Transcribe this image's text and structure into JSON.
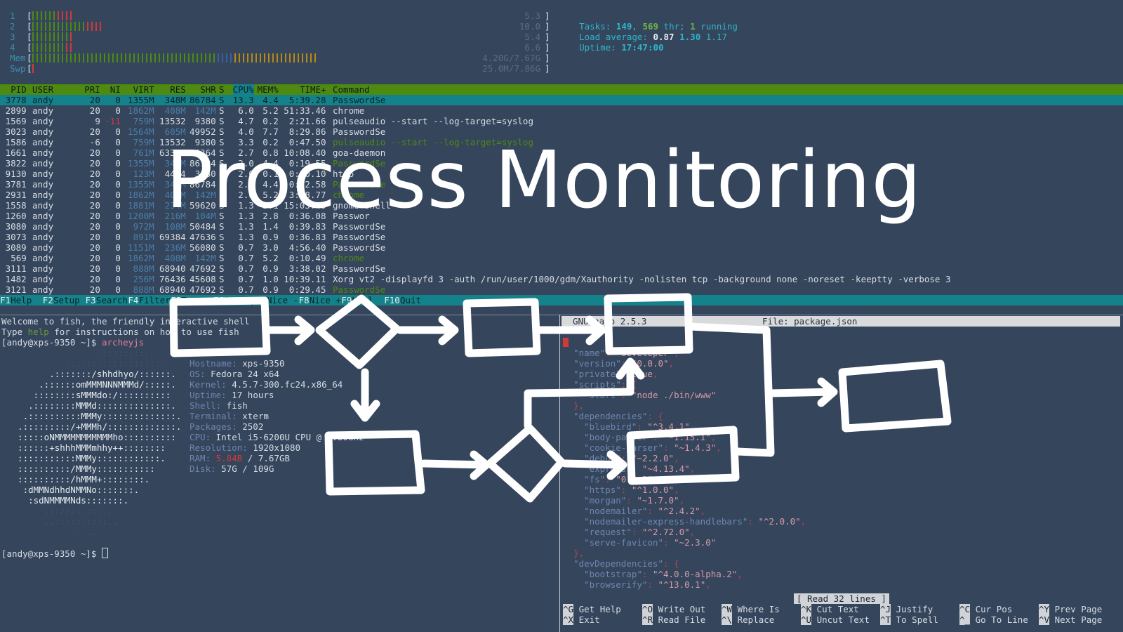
{
  "htop": {
    "meters": [
      {
        "label": "1",
        "value": "5.3",
        "segs": [
          [
            "#4f8a10",
            6
          ],
          [
            "#d23a3a",
            4
          ]
        ]
      },
      {
        "label": "2",
        "value": "10.0",
        "segs": [
          [
            "#4f8a10",
            13
          ],
          [
            "#d23a3a",
            4
          ]
        ]
      },
      {
        "label": "3",
        "value": "5.4",
        "segs": [
          [
            "#4f8a10",
            9
          ],
          [
            "#d23a3a",
            1
          ]
        ]
      },
      {
        "label": "4",
        "value": "6.6",
        "segs": [
          [
            "#4f8a10",
            8
          ],
          [
            "#d23a3a",
            2
          ]
        ]
      },
      {
        "label": "Mem",
        "value": "4.20G/7.67G",
        "segs": [
          [
            "#4f8a10",
            44
          ],
          [
            "#3d5fa0",
            4
          ],
          [
            "#b88a10",
            20
          ]
        ]
      },
      {
        "label": "Swp",
        "value": "25.0M/7.86G",
        "segs": [
          [
            "#d23a3a",
            1
          ]
        ]
      }
    ],
    "tasks_label": "Tasks:",
    "tasks_count": "149",
    "tasks_thr_count": "569",
    "tasks_thr_label": "thr;",
    "tasks_running_count": "1",
    "tasks_running_label": "running",
    "load_label": "Load average:",
    "load_1": "0.87",
    "load_5": "1.30",
    "load_15": "1.17",
    "uptime_label": "Uptime:",
    "uptime_value": "17:47:00",
    "columns": [
      "PID",
      "USER",
      "PRI",
      "NI",
      "VIRT",
      "RES",
      "SHR",
      "S",
      "CPU%",
      "MEM%",
      "TIME+",
      "Command"
    ],
    "rows": [
      [
        "3778",
        "andy",
        "20",
        "0",
        "1355M",
        "348M",
        "86784",
        "S",
        "13.3",
        "4.4",
        "5:39.28",
        "PasswordSe"
      ],
      [
        "2899",
        "andy",
        "20",
        "0",
        "1862M",
        "408M",
        "142M",
        "S",
        "6.0",
        "5.2",
        "51:33.46",
        "chrome"
      ],
      [
        "1569",
        "andy",
        "9",
        "-11",
        "759M",
        "13532",
        "9380",
        "S",
        "4.7",
        "0.2",
        "2:21.66",
        "pulseaudio --start --log-target=syslog"
      ],
      [
        "3023",
        "andy",
        "20",
        "0",
        "1564M",
        "605M",
        "49952",
        "S",
        "4.0",
        "7.7",
        "8:29.86",
        "PasswordSe"
      ],
      [
        "1586",
        "andy",
        "-6",
        "0",
        "759M",
        "13532",
        "9380",
        "S",
        "3.3",
        "0.2",
        "0:47.50",
        "pulseaudio --start --log-target=syslog"
      ],
      [
        "1661",
        "andy",
        "20",
        "0",
        "761M",
        "63364",
        "46364",
        "S",
        "2.7",
        "0.8",
        "10:08.40",
        "goa-daemon"
      ],
      [
        "3822",
        "andy",
        "20",
        "0",
        "1355M",
        "348M",
        "86784",
        "S",
        "2.0",
        "4.4",
        "0:19.55",
        "PasswordSe"
      ],
      [
        "9130",
        "andy",
        "20",
        "0",
        "123M",
        "4444",
        "3160",
        "R",
        "2.0",
        "0.1",
        "0:00.10",
        "htop"
      ],
      [
        "3781",
        "andy",
        "20",
        "0",
        "1355M",
        "348M",
        "86784",
        "S",
        "2.0",
        "4.4",
        "0:12.58",
        "PasswordSe"
      ],
      [
        "2931",
        "andy",
        "20",
        "0",
        "1862M",
        "408M",
        "142M",
        "S",
        "2.0",
        "5.2",
        "3:18.77",
        "chrome"
      ],
      [
        "1558",
        "andy",
        "20",
        "0",
        "1881M",
        "234M",
        "59620",
        "S",
        "1.3",
        "3.1",
        "15:03.40",
        "gnome-shell"
      ],
      [
        "1260",
        "andy",
        "20",
        "0",
        "1200M",
        "216M",
        "104M",
        "S",
        "1.3",
        "2.8",
        "0:36.08",
        "Passwor"
      ],
      [
        "3080",
        "andy",
        "20",
        "0",
        "972M",
        "108M",
        "50484",
        "S",
        "1.3",
        "1.4",
        "0:39.83",
        "PasswordSe"
      ],
      [
        "3073",
        "andy",
        "20",
        "0",
        "891M",
        "69384",
        "47636",
        "S",
        "1.3",
        "0.9",
        "0:36.83",
        "PasswordSe"
      ],
      [
        "3089",
        "andy",
        "20",
        "0",
        "1151M",
        "236M",
        "56080",
        "S",
        "0.7",
        "3.0",
        "4:56.40",
        "PasswordSe"
      ],
      [
        "569",
        "andy",
        "20",
        "0",
        "1862M",
        "408M",
        "142M",
        "S",
        "0.7",
        "5.2",
        "0:10.49",
        "chrome"
      ],
      [
        "3111",
        "andy",
        "20",
        "0",
        "888M",
        "68940",
        "47692",
        "S",
        "0.7",
        "0.9",
        "3:38.02",
        "PasswordSe"
      ],
      [
        "1482",
        "andy",
        "20",
        "0",
        "256M",
        "76436",
        "45608",
        "S",
        "0.7",
        "1.0",
        "10:39.11",
        "Xorg vt2 -displayfd 3 -auth /run/user/1000/gdm/Xauthority -nolisten tcp -background none -noreset -keeptty -verbose 3"
      ],
      [
        "3121",
        "andy",
        "20",
        "0",
        "888M",
        "68940",
        "47692",
        "S",
        "0.7",
        "0.9",
        "0:29.45",
        "PasswordSe"
      ]
    ],
    "fkeys": [
      {
        "key": "F1",
        "label": "Help"
      },
      {
        "key": "F2",
        "label": "Setup"
      },
      {
        "key": "F3",
        "label": "Search"
      },
      {
        "key": "F4",
        "label": "Filter"
      },
      {
        "key": "F5",
        "label": "Tree"
      },
      {
        "key": "F6",
        "label": "SortBy"
      },
      {
        "key": "F7",
        "label": "Nice -"
      },
      {
        "key": "F8",
        "label": "Nice +"
      },
      {
        "key": "F9",
        "label": "Kill"
      },
      {
        "key": "F10",
        "label": "Quit"
      }
    ]
  },
  "fish": {
    "welcome_prefix": "Welcome to fish, the friendly interactive shell",
    "type_prefix": "Type",
    "help_word": "help",
    "type_suffix": "for instructions on how to use fish",
    "prompt": "[andy@xps-9350 ~]$",
    "command": "archeyjs",
    "logo": [
      "                 .:::::::::.",
      "           ..:::::::::::::::..",
      "        .:::::::/shhdhyo/::::::.",
      "      .::::::omMMMNNNMMMd/:::::.",
      "     ::::::::sMMMdo:/::::::::::",
      "    .::::::::MMMd::::::::::::::.",
      "   .::::::::::MMMy::::::::::::::.",
      "  .:::::::::/+MMMh/:::::::::::::.",
      "  :::::oNMMMMMMMMMMMho::::::::::",
      "  ::::::+shhhMMMmhhy++::::::::",
      "  :::::::::::MMMy::::::::::::.",
      "  ::::::::::/MMMy:::::::::::",
      "  ::::::::::/hMMM+::::::::.",
      "   :dMMNdhhdNMMNo:::::::.",
      "    :sdNMMMMNds:::::::.",
      "       ::://:::::::.",
      "       ..::::::::::..",
      "             ...."
    ],
    "info": [
      {
        "k": "Hostname:",
        "v": "xps-9350"
      },
      {
        "k": "OS:",
        "v": "Fedora 24 x64"
      },
      {
        "k": "Kernel:",
        "v": "4.5.7-300.fc24.x86_64"
      },
      {
        "k": "Uptime:",
        "v": "17 hours"
      },
      {
        "k": "Shell:",
        "v": "fish"
      },
      {
        "k": "Terminal:",
        "v": "xterm"
      },
      {
        "k": "Packages:",
        "v": "2502"
      },
      {
        "k": "CPU:",
        "v": "Intel i5-6200U CPU @ 2.30GHz"
      },
      {
        "k": "Resolution:",
        "v": "1920x1080"
      },
      {
        "k": "RAM:",
        "v": "5.84B",
        "v2": "/ 7.67GB"
      },
      {
        "k": "Disk:",
        "v": "57G / 109G"
      }
    ],
    "prompt2": "[andy@xps-9350 ~]$"
  },
  "nano": {
    "version": "GNU nano 2.5.3",
    "file": "File: package.json",
    "lines": [
      [
        [
          "{",
          "p"
        ]
      ],
      [
        [
          "  \"name\"",
          "k"
        ],
        [
          ": ",
          "p"
        ],
        [
          "\"developer\"",
          "s"
        ],
        [
          ",",
          "p"
        ]
      ],
      [
        [
          "  \"version\"",
          "k"
        ],
        [
          ": ",
          "p"
        ],
        [
          "\"0.0.0\"",
          "s"
        ],
        [
          ",",
          "p"
        ]
      ],
      [
        [
          "  \"private\"",
          "k"
        ],
        [
          ": ",
          "p"
        ],
        [
          "true",
          "s"
        ],
        [
          ",",
          "p"
        ]
      ],
      [
        [
          "  \"scripts\"",
          "k"
        ],
        [
          ": {",
          "p"
        ]
      ],
      [
        [
          "    \"start\"",
          "k"
        ],
        [
          ": ",
          "p"
        ],
        [
          "\"node ./bin/www\"",
          "s"
        ]
      ],
      [
        [
          "  },",
          "p"
        ]
      ],
      [
        [
          "  \"dependencies\"",
          "k"
        ],
        [
          ": {",
          "p"
        ]
      ],
      [
        [
          "    \"bluebird\"",
          "k"
        ],
        [
          ": ",
          "p"
        ],
        [
          "\"^3.4.1\"",
          "s"
        ],
        [
          ",",
          "p"
        ]
      ],
      [
        [
          "    \"body-parser\"",
          "k"
        ],
        [
          ": ",
          "p"
        ],
        [
          "\"~1.15.1\"",
          "s"
        ],
        [
          ",",
          "p"
        ]
      ],
      [
        [
          "    \"cookie-parser\"",
          "k"
        ],
        [
          ": ",
          "p"
        ],
        [
          "\"~1.4.3\"",
          "s"
        ],
        [
          ",",
          "p"
        ]
      ],
      [
        [
          "    \"debug\"",
          "k"
        ],
        [
          ": ",
          "p"
        ],
        [
          "\"~2.2.0\"",
          "s"
        ],
        [
          ",",
          "p"
        ]
      ],
      [
        [
          "    \"express\"",
          "k"
        ],
        [
          ": ",
          "p"
        ],
        [
          "\"~4.13.4\"",
          "s"
        ],
        [
          ",",
          "p"
        ]
      ],
      [
        [
          "    \"fs\"",
          "k"
        ],
        [
          ": ",
          "p"
        ],
        [
          "\"0.0.2\"",
          "s"
        ],
        [
          ",",
          "p"
        ]
      ],
      [
        [
          "    \"https\"",
          "k"
        ],
        [
          ": ",
          "p"
        ],
        [
          "\"^1.0.0\"",
          "s"
        ],
        [
          ",",
          "p"
        ]
      ],
      [
        [
          "    \"morgan\"",
          "k"
        ],
        [
          ": ",
          "p"
        ],
        [
          "\"~1.7.0\"",
          "s"
        ],
        [
          ",",
          "p"
        ]
      ],
      [
        [
          "    \"nodemailer\"",
          "k"
        ],
        [
          ": ",
          "p"
        ],
        [
          "\"^2.4.2\"",
          "s"
        ],
        [
          ",",
          "p"
        ]
      ],
      [
        [
          "    \"nodemailer-express-handlebars\"",
          "k"
        ],
        [
          ": ",
          "p"
        ],
        [
          "\"^2.0.0\"",
          "s"
        ],
        [
          ",",
          "p"
        ]
      ],
      [
        [
          "    \"request\"",
          "k"
        ],
        [
          ": ",
          "p"
        ],
        [
          "\"^2.72.0\"",
          "s"
        ],
        [
          ",",
          "p"
        ]
      ],
      [
        [
          "    \"serve-favicon\"",
          "k"
        ],
        [
          ": ",
          "p"
        ],
        [
          "\"~2.3.0\"",
          "s"
        ]
      ],
      [
        [
          "  },",
          "p"
        ]
      ],
      [
        [
          "  \"devDependencies\"",
          "k"
        ],
        [
          ": {",
          "p"
        ]
      ],
      [
        [
          "    \"bootstrap\"",
          "k"
        ],
        [
          ": ",
          "p"
        ],
        [
          "\"^4.0.0-alpha.2\"",
          "s"
        ],
        [
          ",",
          "p"
        ]
      ],
      [
        [
          "    \"browserify\"",
          "k"
        ],
        [
          ": ",
          "p"
        ],
        [
          "\"^13.0.1\"",
          "s"
        ],
        [
          ",",
          "p"
        ]
      ]
    ],
    "status": "[ Read 32 lines ]",
    "shortcuts": [
      [
        {
          "k": "^G",
          "l": "Get Help"
        },
        {
          "k": "^X",
          "l": "Exit"
        }
      ],
      [
        {
          "k": "^O",
          "l": "Write Out"
        },
        {
          "k": "^R",
          "l": "Read File"
        }
      ],
      [
        {
          "k": "^W",
          "l": "Where Is"
        },
        {
          "k": "^\\",
          "l": "Replace"
        }
      ],
      [
        {
          "k": "^K",
          "l": "Cut Text"
        },
        {
          "k": "^U",
          "l": "Uncut Text"
        }
      ],
      [
        {
          "k": "^J",
          "l": "Justify"
        },
        {
          "k": "^T",
          "l": "To Spell"
        }
      ],
      [
        {
          "k": "^C",
          "l": "Cur Pos"
        },
        {
          "k": "^_",
          "l": "Go To Line"
        }
      ],
      [
        {
          "k": "^Y",
          "l": "Prev Page"
        },
        {
          "k": "^V",
          "l": "Next Page"
        }
      ]
    ]
  },
  "overlay": {
    "title": "Process Monitoring",
    "icon": "flowchart-icon"
  },
  "colors": {
    "background": "#34455c",
    "header_green": "#4f8a10",
    "selection_teal": "#14828a",
    "cyan": "#2fb6c8",
    "overlay": "#ffffff"
  }
}
